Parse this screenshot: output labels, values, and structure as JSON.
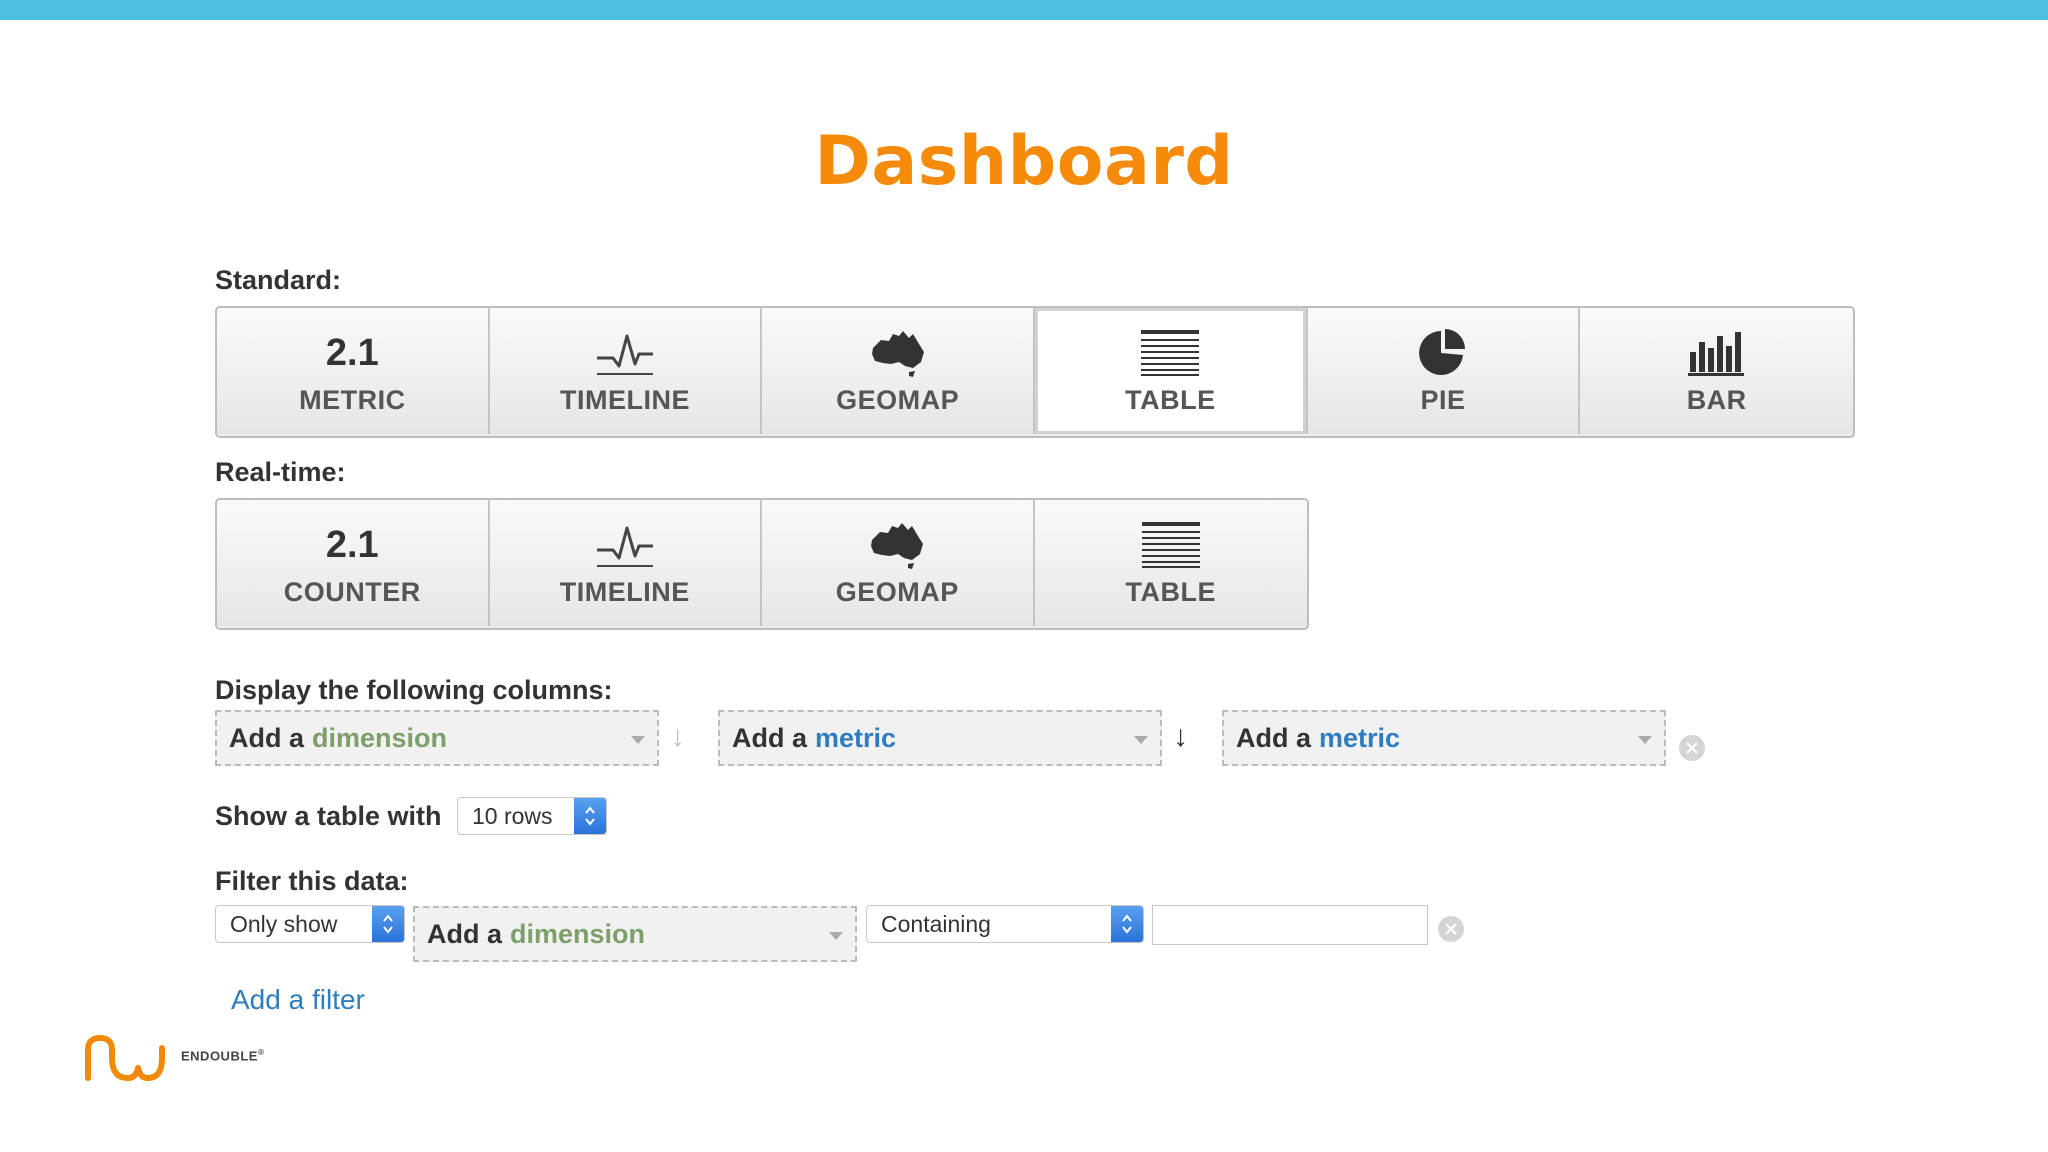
{
  "page": {
    "title": "Dashboard"
  },
  "colors": {
    "accent": "#f58a0b",
    "topbar": "#4bbfe0",
    "dimension": "#7e9e6b",
    "metric": "#2e7dbe",
    "link": "#2e7dbe"
  },
  "standard": {
    "label": "Standard:",
    "buttons": [
      {
        "label": "METRIC",
        "icon_text": "2.1",
        "icon": "metric-number-icon",
        "selected": false
      },
      {
        "label": "TIMELINE",
        "icon": "timeline-pulse-icon",
        "selected": false
      },
      {
        "label": "GEOMAP",
        "icon": "australia-map-icon",
        "selected": false
      },
      {
        "label": "TABLE",
        "icon": "table-lines-icon",
        "selected": true
      },
      {
        "label": "PIE",
        "icon": "pie-chart-icon",
        "selected": false
      },
      {
        "label": "BAR",
        "icon": "bar-chart-icon",
        "selected": false
      }
    ]
  },
  "realtime": {
    "label": "Real-time:",
    "buttons": [
      {
        "label": "COUNTER",
        "icon_text": "2.1",
        "icon": "counter-number-icon"
      },
      {
        "label": "TIMELINE",
        "icon": "timeline-pulse-icon"
      },
      {
        "label": "GEOMAP",
        "icon": "australia-map-icon"
      },
      {
        "label": "TABLE",
        "icon": "table-lines-icon"
      }
    ]
  },
  "columns": {
    "label": "Display the following columns:",
    "selects": [
      {
        "prefix": "Add a",
        "keyword": "dimension",
        "kind": "dimension"
      },
      {
        "prefix": "Add a",
        "keyword": "metric",
        "kind": "metric"
      },
      {
        "prefix": "Add a",
        "keyword": "metric",
        "kind": "metric"
      }
    ]
  },
  "rows": {
    "label": "Show a table with",
    "value": "10 rows"
  },
  "filter": {
    "label": "Filter this data:",
    "mode": "Only show",
    "dimension": {
      "prefix": "Add a",
      "keyword": "dimension"
    },
    "condition": "Containing",
    "value": "",
    "add_link": "Add a filter"
  },
  "logo": {
    "text": "ENDOUBLE",
    "mark": "®"
  }
}
